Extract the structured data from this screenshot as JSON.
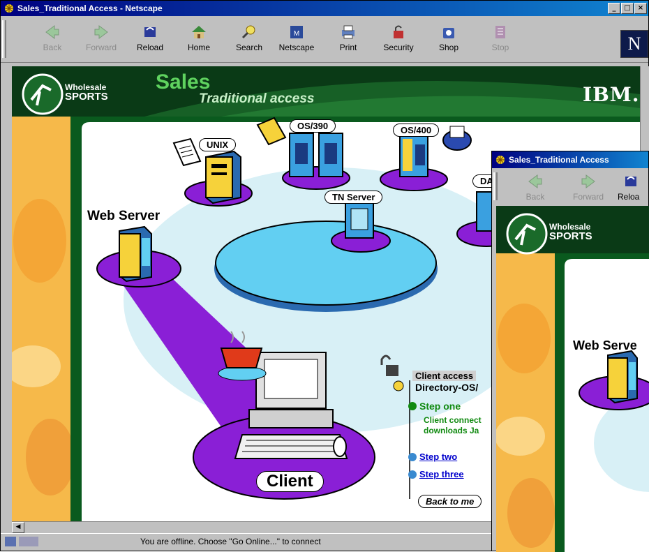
{
  "main_window": {
    "title": "Sales_Traditional Access - Netscape",
    "toolbar": [
      {
        "label": "Back",
        "icon": "back-icon",
        "enabled": false
      },
      {
        "label": "Forward",
        "icon": "forward-icon",
        "enabled": false
      },
      {
        "label": "Reload",
        "icon": "reload-icon",
        "enabled": true
      },
      {
        "label": "Home",
        "icon": "home-icon",
        "enabled": true
      },
      {
        "label": "Search",
        "icon": "search-icon",
        "enabled": true
      },
      {
        "label": "Netscape",
        "icon": "netscape-icon",
        "enabled": true
      },
      {
        "label": "Print",
        "icon": "print-icon",
        "enabled": true
      },
      {
        "label": "Security",
        "icon": "security-icon",
        "enabled": true
      },
      {
        "label": "Shop",
        "icon": "shop-icon",
        "enabled": true
      },
      {
        "label": "Stop",
        "icon": "stop-icon",
        "enabled": false
      }
    ],
    "status_text": "You are offline. Choose \"Go Online...\" to connect"
  },
  "page": {
    "logo_line1": "Wholesale",
    "logo_line2": "SPORTS",
    "heading": "Sales",
    "subheading": "Traditional access",
    "brand": "IBM.",
    "labels": {
      "unix": "UNIX",
      "os390": "OS/390",
      "os400": "OS/400",
      "dat": "DAT",
      "tn_server": "TN Server",
      "web_server": "Web Server",
      "client": "Client"
    },
    "side_panel": {
      "title": "Client access",
      "directory": "Directory-OS/",
      "step_one": "Step one",
      "step_one_text_1": "Client connect",
      "step_one_text_2": "downloads Ja",
      "step_two": "Step two",
      "step_three": "Step three",
      "back": "Back to me"
    }
  },
  "second_window": {
    "title": "Sales_Traditional Access",
    "toolbar": [
      {
        "label": "Back",
        "enabled": false
      },
      {
        "label": "Forward",
        "enabled": false
      },
      {
        "label": "Reloa",
        "enabled": true
      }
    ],
    "logo_line1": "Wholesale",
    "logo_line2": "SPORTS",
    "web_server_label": "Web Serve"
  },
  "colors": {
    "title_bar": "#000080",
    "page_green": "#0a4a1a",
    "accent_purple": "#8a1fd6",
    "ellipse_blue": "#5ecff2",
    "side_orange": "#f6b94a",
    "link_blue": "#0000cc",
    "step_green": "#118a11"
  }
}
